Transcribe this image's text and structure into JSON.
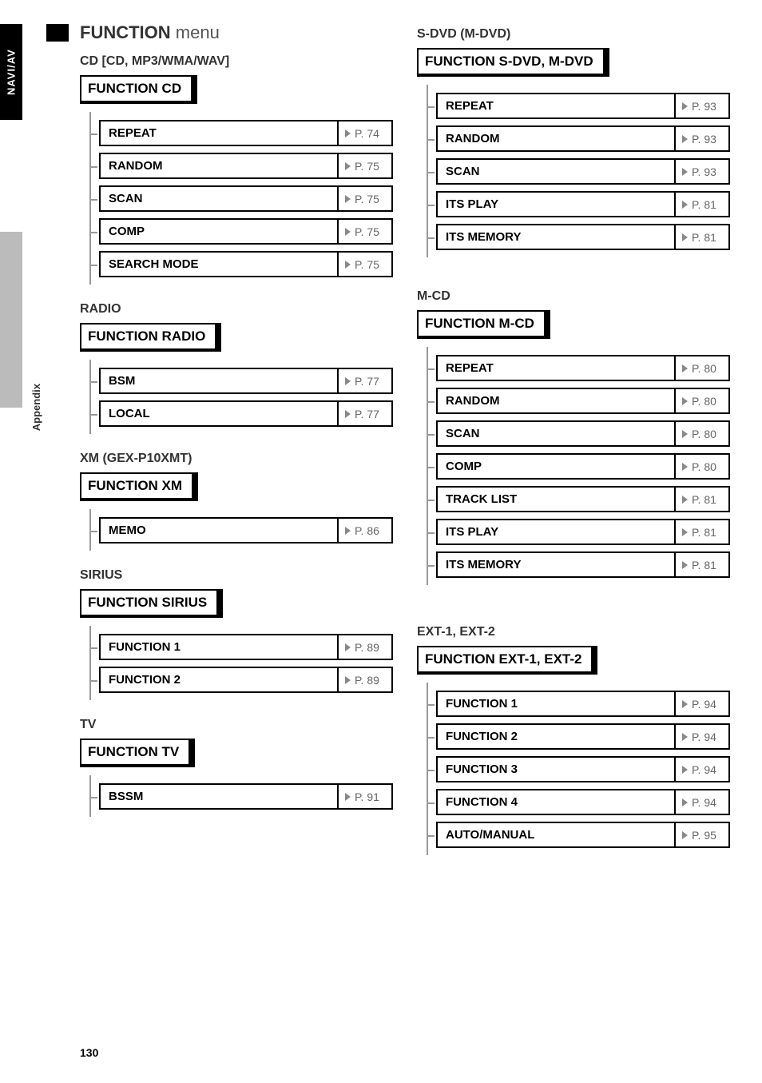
{
  "side_tabs": {
    "naviav": "NAVI/AV",
    "appendix": "Appendix"
  },
  "page_number": "130",
  "main_title_strong": "FUNCTION",
  "main_title_light": "menu",
  "left": {
    "cd": {
      "heading": "CD [CD, MP3/WMA/WAV]",
      "tag": "FUNCTION CD",
      "items": [
        {
          "label": "REPEAT",
          "page": "P. 74"
        },
        {
          "label": "RANDOM",
          "page": "P. 75"
        },
        {
          "label": "SCAN",
          "page": "P. 75"
        },
        {
          "label": "COMP",
          "page": "P. 75"
        },
        {
          "label": "SEARCH MODE",
          "page": "P. 75"
        }
      ]
    },
    "radio": {
      "heading": "RADIO",
      "tag": "FUNCTION RADIO",
      "items": [
        {
          "label": "BSM",
          "page": "P. 77"
        },
        {
          "label": "LOCAL",
          "page": "P. 77"
        }
      ]
    },
    "xm": {
      "heading": "XM (GEX-P10XMT)",
      "tag": "FUNCTION XM",
      "items": [
        {
          "label": "MEMO",
          "page": "P. 86"
        }
      ]
    },
    "sirius": {
      "heading": "SIRIUS",
      "tag": "FUNCTION SIRIUS",
      "items": [
        {
          "label": "FUNCTION 1",
          "page": "P. 89"
        },
        {
          "label": "FUNCTION 2",
          "page": "P. 89"
        }
      ]
    },
    "tv": {
      "heading": "TV",
      "tag": "FUNCTION TV",
      "items": [
        {
          "label": "BSSM",
          "page": "P. 91"
        }
      ]
    }
  },
  "right": {
    "sdvd": {
      "heading": "S-DVD (M-DVD)",
      "tag": "FUNCTION S-DVD, M-DVD",
      "items": [
        {
          "label": "REPEAT",
          "page": "P. 93"
        },
        {
          "label": "RANDOM",
          "page": "P. 93"
        },
        {
          "label": "SCAN",
          "page": "P. 93"
        },
        {
          "label": "ITS PLAY",
          "page": "P. 81"
        },
        {
          "label": "ITS MEMORY",
          "page": "P. 81"
        }
      ]
    },
    "mcd": {
      "heading": "M-CD",
      "tag": "FUNCTION M-CD",
      "items": [
        {
          "label": "REPEAT",
          "page": "P. 80"
        },
        {
          "label": "RANDOM",
          "page": "P. 80"
        },
        {
          "label": "SCAN",
          "page": "P. 80"
        },
        {
          "label": "COMP",
          "page": "P. 80"
        },
        {
          "label": "TRACK LIST",
          "page": "P. 81"
        },
        {
          "label": "ITS PLAY",
          "page": "P. 81"
        },
        {
          "label": "ITS MEMORY",
          "page": "P. 81"
        }
      ]
    },
    "ext": {
      "heading": "EXT-1, EXT-2",
      "tag": "FUNCTION EXT-1, EXT-2",
      "items": [
        {
          "label": "FUNCTION 1",
          "page": "P. 94"
        },
        {
          "label": "FUNCTION 2",
          "page": "P. 94"
        },
        {
          "label": "FUNCTION 3",
          "page": "P. 94"
        },
        {
          "label": "FUNCTION 4",
          "page": "P. 94"
        },
        {
          "label": "AUTO/MANUAL",
          "page": "P. 95"
        }
      ]
    }
  }
}
